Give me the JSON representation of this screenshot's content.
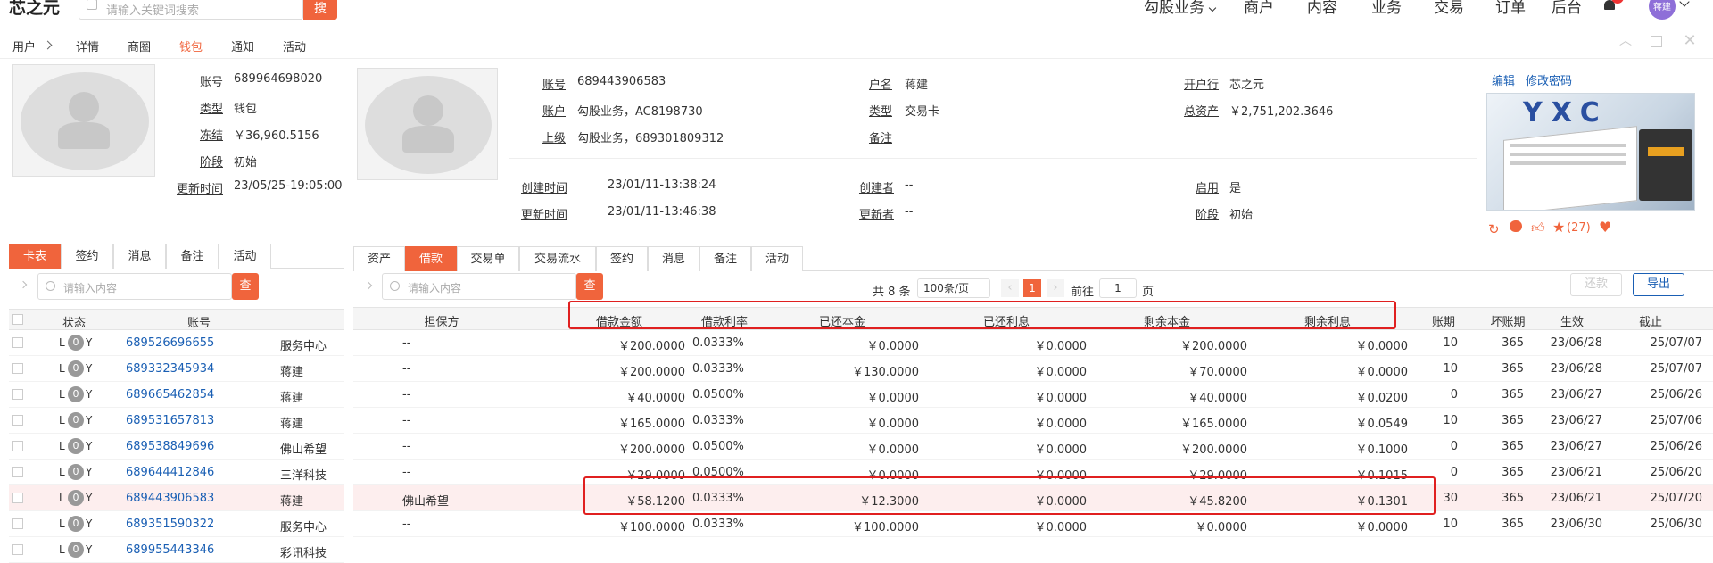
{
  "topbar": {
    "logo": "芯之元",
    "search_placeholder": "请输入关键词搜索",
    "search_button": "搜",
    "nav": [
      "勾股业务",
      "商户",
      "内容",
      "业务",
      "交易",
      "订单",
      "后台"
    ],
    "user_avatar_text": "蒋建"
  },
  "breadcrumb": {
    "root": "用户",
    "items": [
      "详情",
      "商圈",
      "钱包",
      "通知",
      "活动"
    ],
    "active": "钱包"
  },
  "wallet": {
    "account_label": "账号",
    "account": "689964698020",
    "type_label": "类型",
    "type": "钱包",
    "frozen_label": "冻结",
    "frozen": "￥36,960.5156",
    "stage_label": "阶段",
    "stage": "初始",
    "updated_label": "更新时间",
    "updated": "23/05/25-19:05:00"
  },
  "left_tabs": [
    "卡表",
    "签约",
    "消息",
    "备注",
    "活动"
  ],
  "left_search_placeholder": "请输入内容",
  "left_search_button": "查",
  "left_table": {
    "headers": [
      "状态",
      "账号"
    ],
    "rows": [
      {
        "l": "L",
        "o": "0",
        "y": "Y",
        "account": "689526696655",
        "name": "服务中心"
      },
      {
        "l": "L",
        "o": "0",
        "y": "Y",
        "account": "689332345934",
        "name": "蒋建"
      },
      {
        "l": "L",
        "o": "0",
        "y": "Y",
        "account": "689665462854",
        "name": "蒋建"
      },
      {
        "l": "L",
        "o": "0",
        "y": "Y",
        "account": "689531657813",
        "name": "蒋建"
      },
      {
        "l": "L",
        "o": "0",
        "y": "Y",
        "account": "689538849696",
        "name": "佛山希望"
      },
      {
        "l": "L",
        "o": "0",
        "y": "Y",
        "account": "689644412846",
        "name": "三洋科技"
      },
      {
        "l": "L",
        "o": "0",
        "y": "Y",
        "account": "689443906583",
        "name": "蒋建"
      },
      {
        "l": "L",
        "o": "0",
        "y": "Y",
        "account": "689351590322",
        "name": "服务中心"
      },
      {
        "l": "L",
        "o": "0",
        "y": "Y",
        "account": "689955443346",
        "name": "彩讯科技"
      }
    ]
  },
  "card": {
    "account_label": "账号",
    "account": "689443906583",
    "holder_label": "户名",
    "holder": "蒋建",
    "bank_label": "开户行",
    "bank": "芯之元",
    "acct_owner_label": "账户",
    "acct_owner": "勾股业务，AC8198730",
    "type_label": "类型",
    "type": "交易卡",
    "assets_label": "总资产",
    "assets": "￥2,751,202.3646",
    "parent_label": "上级",
    "parent": "勾股业务，689301809312",
    "remark_label": "备注",
    "remark": "",
    "created_label": "创建时间",
    "created": "23/01/11-13:38:24",
    "creator_label": "创建者",
    "creator": "--",
    "enabled_label": "启用",
    "enabled": "是",
    "updated_label": "更新时间",
    "updated": "23/01/11-13:46:38",
    "updater_label": "更新者",
    "updater": "--",
    "stage_label": "阶段",
    "stage": "初始",
    "edit_link": "编辑",
    "password_link": "修改密码",
    "favorites": "(27)",
    "thumbnail_text": "YXC"
  },
  "right_tabs": [
    "资产",
    "借款",
    "交易单",
    "交易流水",
    "签约",
    "消息",
    "备注",
    "活动"
  ],
  "right_active_tab": "借款",
  "right_search_placeholder": "请输入内容",
  "right_search_button": "查",
  "pagination": {
    "total": "共 8 条",
    "page_size": "100条/页",
    "current": "1",
    "goto_label": "前往",
    "goto_value": "1",
    "page_suffix": "页"
  },
  "buttons": {
    "repay": "还款",
    "export": "导出"
  },
  "loan_table": {
    "headers": [
      "担保方",
      "借款金额",
      "借款利率",
      "已还本金",
      "已还利息",
      "剩余本金",
      "剩余利息",
      "账期",
      "坏账期",
      "生效",
      "截止"
    ],
    "rows": [
      [
        "--",
        "￥200.0000",
        "0.0333%",
        "￥0.0000",
        "￥0.0000",
        "￥200.0000",
        "￥0.0000",
        "10",
        "365",
        "23/06/28",
        "25/07/07"
      ],
      [
        "--",
        "￥200.0000",
        "0.0333%",
        "￥130.0000",
        "￥0.0000",
        "￥70.0000",
        "￥0.0000",
        "10",
        "365",
        "23/06/28",
        "25/07/07"
      ],
      [
        "--",
        "￥40.0000",
        "0.0500%",
        "￥0.0000",
        "￥0.0000",
        "￥40.0000",
        "￥0.0200",
        "0",
        "365",
        "23/06/27",
        "25/06/26"
      ],
      [
        "--",
        "￥165.0000",
        "0.0333%",
        "￥0.0000",
        "￥0.0000",
        "￥165.0000",
        "￥0.0549",
        "10",
        "365",
        "23/06/27",
        "25/07/06"
      ],
      [
        "--",
        "￥200.0000",
        "0.0500%",
        "￥0.0000",
        "￥0.0000",
        "￥200.0000",
        "￥0.1000",
        "0",
        "365",
        "23/06/27",
        "25/06/26"
      ],
      [
        "--",
        "￥29.0000",
        "0.0500%",
        "￥0.0000",
        "￥0.0000",
        "￥29.0000",
        "￥0.1015",
        "0",
        "365",
        "23/06/21",
        "25/06/20"
      ],
      [
        "佛山希望",
        "￥58.1200",
        "0.0333%",
        "￥12.3000",
        "￥0.0000",
        "￥45.8200",
        "￥0.1301",
        "30",
        "365",
        "23/06/21",
        "25/07/20"
      ],
      [
        "--",
        "￥100.0000",
        "0.0333%",
        "￥100.0000",
        "￥0.0000",
        "￥0.0000",
        "￥0.0000",
        "10",
        "365",
        "23/06/30",
        "25/06/30"
      ]
    ]
  },
  "colors": {
    "accent": "#f0643c",
    "link": "#1a5fb4",
    "highlight_box": "#e02020",
    "row_highlight": "#fdeeee"
  }
}
